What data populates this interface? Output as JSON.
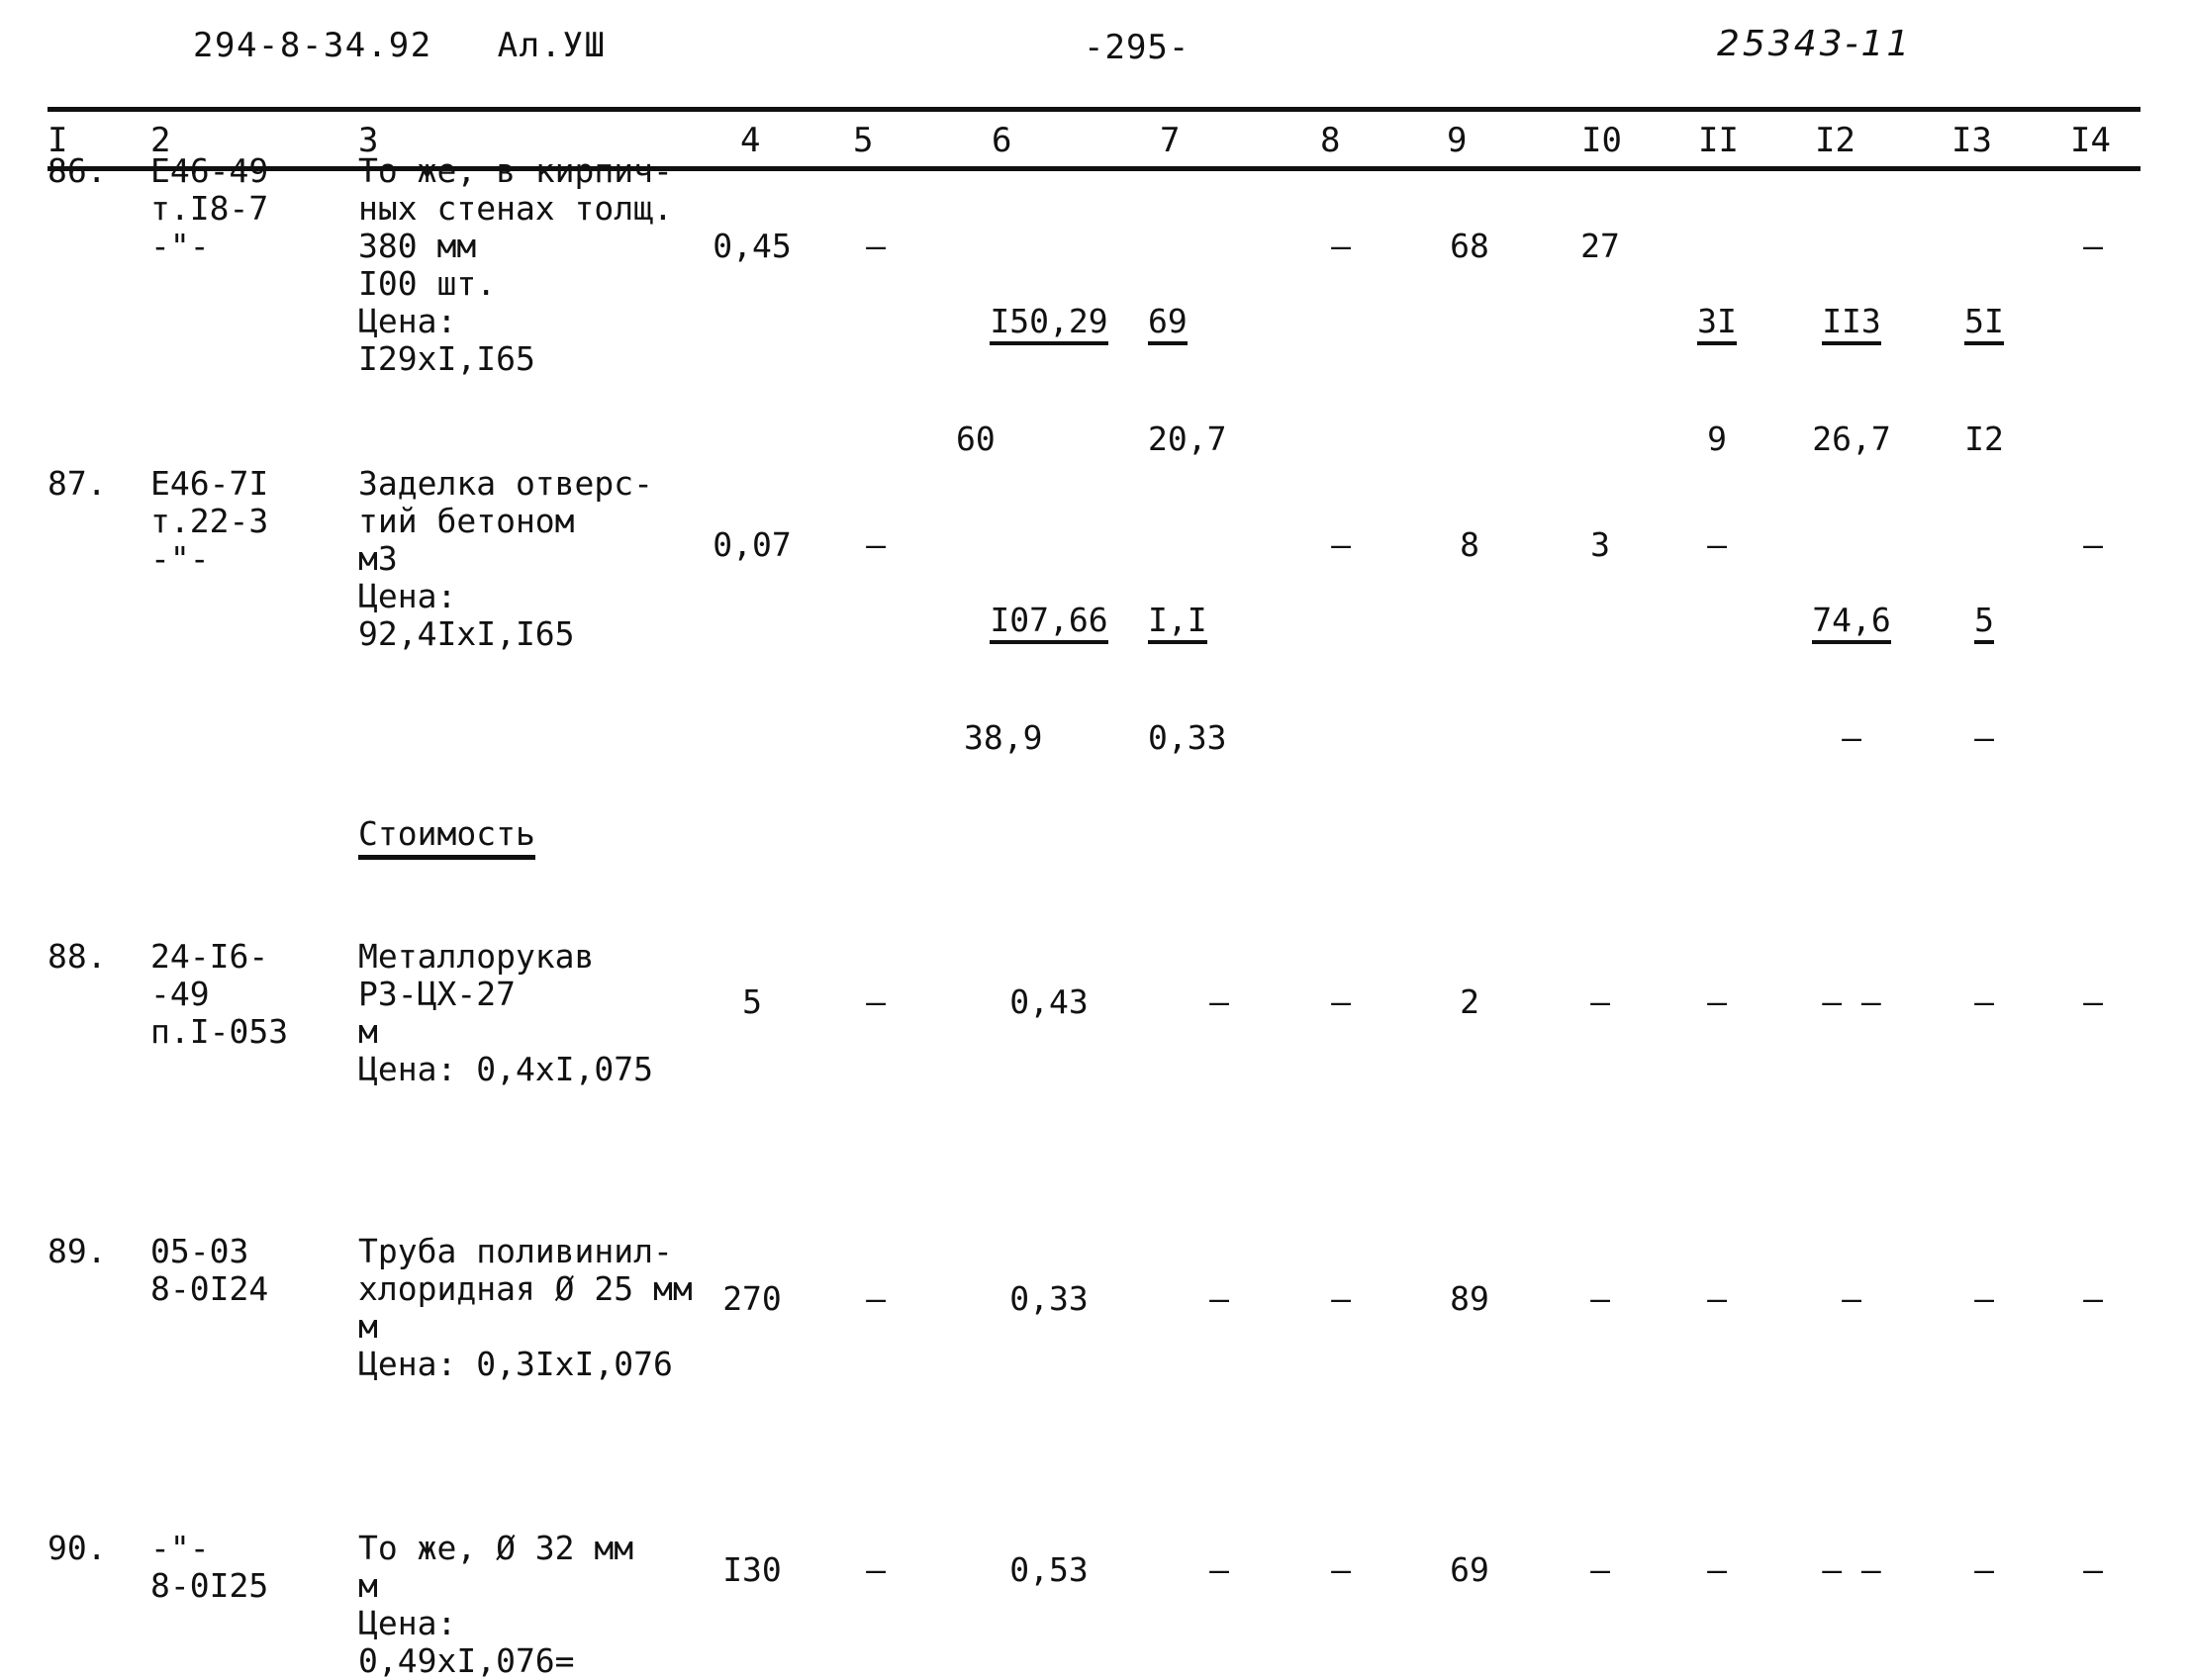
{
  "header": {
    "doc_code": "294-8-34.92",
    "album": "Ал.УШ",
    "page_number": "-295-",
    "serial": "25343-11"
  },
  "table": {
    "column_headers": [
      "I",
      "2",
      "3",
      "4",
      "5",
      "6",
      "7",
      "8",
      "9",
      "I0",
      "II",
      "I2",
      "I3",
      "I4"
    ],
    "section_label": "Стоимость",
    "rows": [
      {
        "no": "86.",
        "code": "Е46-49\nт.I8-7\n-\"-",
        "description": "То же, в кирпич-\nных стенах толщ.\n380 мм\nI00 шт.\nЦена:\nI29xI,I65",
        "c4": "0,45",
        "c5": "–",
        "c6_top": "I50,29",
        "c6_bot": "60",
        "c7_top": "69",
        "c7_bot": "20,7",
        "c8": "–",
        "c9": "68",
        "c10": "27",
        "c11_top": "3I",
        "c11_bot": "9",
        "c12_top": "II3",
        "c12_bot": "26,7",
        "c13_top": "5I",
        "c13_bot": "I2",
        "c14": "–"
      },
      {
        "no": "87.",
        "code": "Е46-7I\nт.22-3\n-\"-",
        "description": "Заделка отверс-\nтий бетоном\nм3\nЦена:\n92,4IxI,I65",
        "c4": "0,07",
        "c5": "–",
        "c6_top": "I07,66",
        "c6_bot": "38,9",
        "c7_top": "I,I",
        "c7_bot": "0,33",
        "c8": "–",
        "c9": "8",
        "c10": "3",
        "c11_top": "–",
        "c11_bot": "",
        "c12_top": "74,6",
        "c12_bot": "–",
        "c13_top": "5",
        "c13_bot": "–",
        "c14": "–"
      },
      {
        "no": "88.",
        "code": "24-I6-\n-49\nп.I-053",
        "description": "Металлорукав\nРЗ-ЦХ-27\nм\nЦена: 0,4xI,075",
        "c4": "5",
        "c5": "–",
        "c6_top": "0,43",
        "c6_bot": "",
        "c7_top": "–",
        "c7_bot": "",
        "c8": "–",
        "c9": "2",
        "c10": "–",
        "c11_top": "–",
        "c11_bot": "",
        "c12_top": "– –",
        "c12_bot": "",
        "c13_top": "–",
        "c13_bot": "",
        "c14": "–"
      },
      {
        "no": "89.",
        "code": "05-03\n8-0I24",
        "description": "Труба поливинил-\nхлоридная Ø 25 мм\nм\nЦена: 0,3IxI,076",
        "c4": "270",
        "c5": "–",
        "c6_top": "0,33",
        "c6_bot": "",
        "c7_top": "–",
        "c7_bot": "",
        "c8": "–",
        "c9": "89",
        "c10": "–",
        "c11_top": "–",
        "c11_bot": "",
        "c12_top": "–",
        "c12_bot": "",
        "c13_top": "–",
        "c13_bot": "",
        "c14": "–"
      },
      {
        "no": "90.",
        "code": "-\"-\n8-0I25",
        "description": "То же, Ø 32 мм\nм\nЦена:\n0,49xI,076=",
        "c4": "I30",
        "c5": "–",
        "c6_top": "0,53",
        "c6_bot": "",
        "c7_top": "–",
        "c7_bot": "",
        "c8": "–",
        "c9": "69",
        "c10": "–",
        "c11_top": "–",
        "c11_bot": "",
        "c12_top": "– –",
        "c12_bot": "",
        "c13_top": "–",
        "c13_bot": "",
        "c14": "–"
      }
    ]
  }
}
